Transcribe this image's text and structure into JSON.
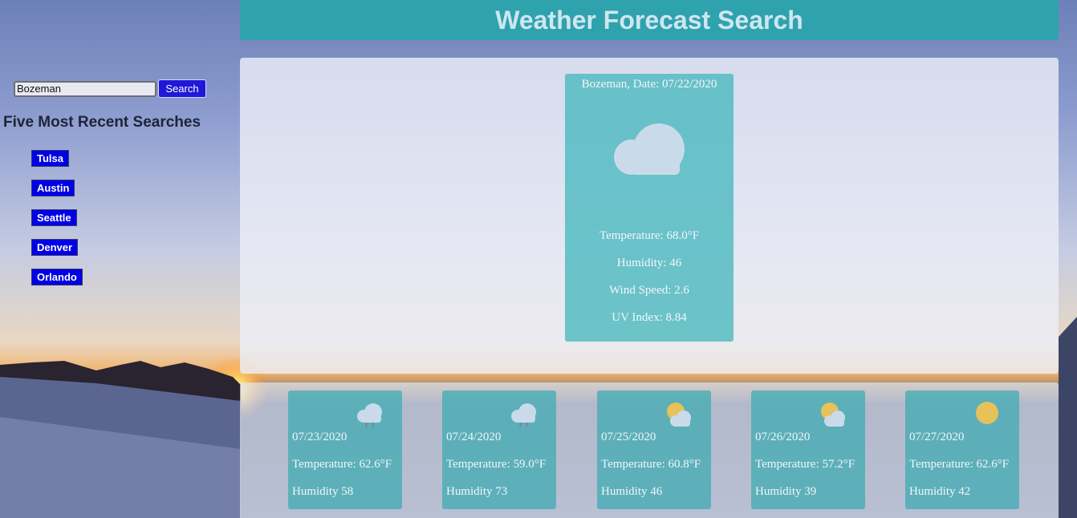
{
  "header": {
    "title": "Weather Forecast Search"
  },
  "search": {
    "value": "Bozeman",
    "button_label": "Search"
  },
  "recent": {
    "title": "Five Most Recent Searches",
    "cities": [
      "Tulsa",
      "Austin",
      "Seattle",
      "Denver",
      "Orlando"
    ]
  },
  "current": {
    "heading": "Bozeman, Date: 07/22/2020",
    "icon": "cloud-icon",
    "temperature": "Temperature: 68.0°F",
    "humidity": "Humidity: 46",
    "wind": "Wind Speed: 2.6",
    "uv": "UV Index: 8.84"
  },
  "forecast": [
    {
      "date": "07/23/2020",
      "temperature": "Temperature: 62.6°F",
      "humidity": "Humidity 58",
      "icon": "rain-cloud-icon"
    },
    {
      "date": "07/24/2020",
      "temperature": "Temperature: 59.0°F",
      "humidity": "Humidity 73",
      "icon": "rain-cloud-icon"
    },
    {
      "date": "07/25/2020",
      "temperature": "Temperature: 60.8°F",
      "humidity": "Humidity 46",
      "icon": "partly-cloudy-icon"
    },
    {
      "date": "07/26/2020",
      "temperature": "Temperature: 57.2°F",
      "humidity": "Humidity 39",
      "icon": "partly-cloudy-icon"
    },
    {
      "date": "07/27/2020",
      "temperature": "Temperature: 62.6°F",
      "humidity": "Humidity 42",
      "icon": "sun-icon"
    }
  ],
  "colors": {
    "header": "#2ea3ad",
    "card": "#48b7be",
    "button": "#0000e6"
  }
}
